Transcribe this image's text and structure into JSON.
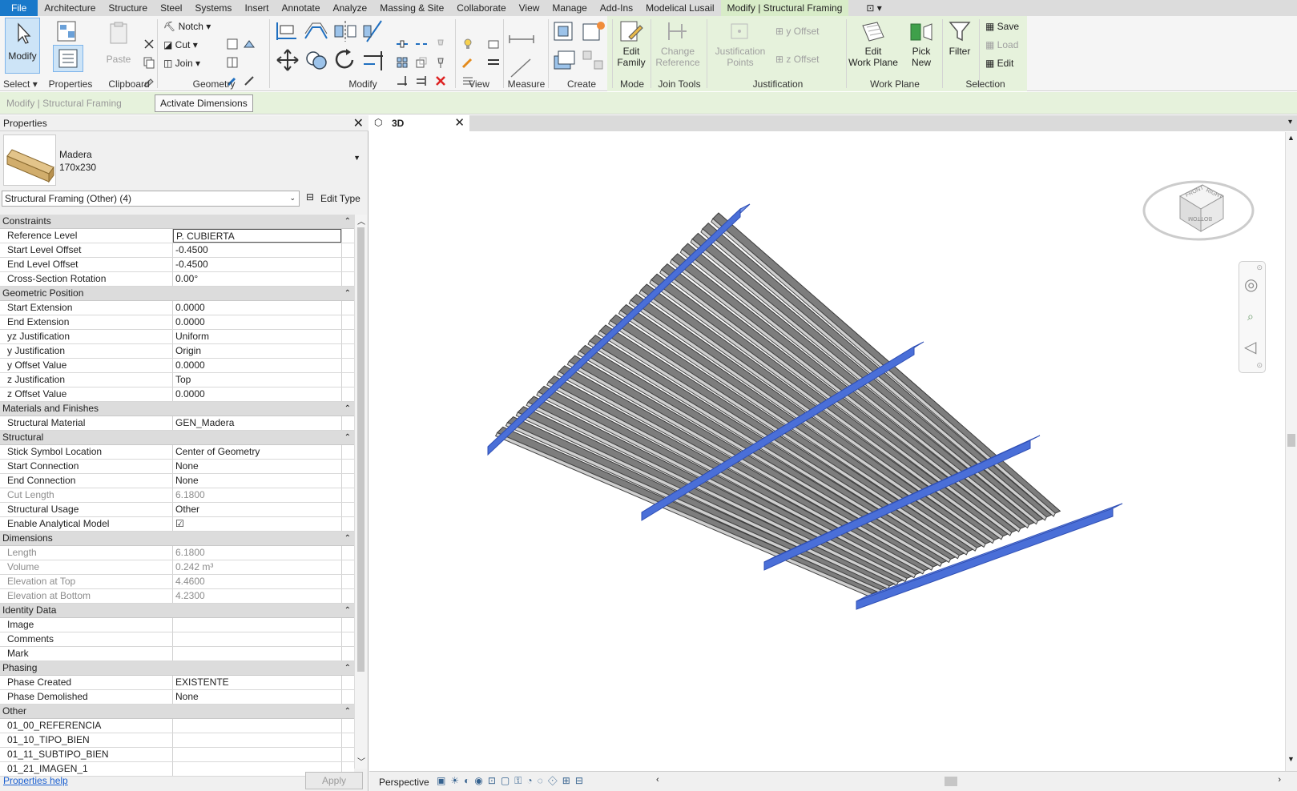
{
  "tabs": [
    "File",
    "Architecture",
    "Structure",
    "Steel",
    "Systems",
    "Insert",
    "Annotate",
    "Analyze",
    "Massing & Site",
    "Collaborate",
    "View",
    "Manage",
    "Add-Ins",
    "Modelical Lusail",
    "Modify | Structural Framing"
  ],
  "ribbon": {
    "modify": "Modify",
    "properties": "Properties",
    "paste": "Paste",
    "notch": "Notch",
    "cut": "Cut",
    "join": "Join",
    "edit_family": [
      "Edit",
      "Family"
    ],
    "change_reference": [
      "Change",
      "Reference"
    ],
    "justification_points": [
      "Justification",
      "Points"
    ],
    "y_offset": "y Offset",
    "z_offset": "z Offset",
    "edit_work_plane": [
      "Edit",
      "Work Plane"
    ],
    "pick_new": [
      "Pick",
      "New"
    ],
    "filter": "Filter",
    "save": "Save",
    "load": "Load",
    "edit": "Edit",
    "groups": [
      "Select",
      "Properties",
      "Clipboard",
      "Geometry",
      "Modify",
      "View",
      "Measure",
      "Create",
      "Mode",
      "Join Tools",
      "Justification",
      "Work Plane",
      "Selection"
    ]
  },
  "option_bar": {
    "context": "Modify | Structural Framing",
    "activate_dimensions": "Activate Dimensions"
  },
  "properties": {
    "title": "Properties",
    "type_name": "Madera",
    "type_size": "170x230",
    "selector": "Structural Framing (Other) (4)",
    "edit_type": "Edit Type",
    "help": "Properties help",
    "apply": "Apply",
    "sections": [
      {
        "name": "Constraints",
        "rows": [
          [
            "Reference Level",
            "P. CUBIERTA"
          ],
          [
            "Start Level Offset",
            "-0.4500"
          ],
          [
            "End Level Offset",
            "-0.4500"
          ],
          [
            "Cross-Section Rotation",
            "0.00°"
          ]
        ]
      },
      {
        "name": "Geometric Position",
        "rows": [
          [
            "Start Extension",
            "0.0000"
          ],
          [
            "End Extension",
            "0.0000"
          ],
          [
            "yz Justification",
            "Uniform"
          ],
          [
            "y Justification",
            "Origin"
          ],
          [
            "y Offset Value",
            "0.0000"
          ],
          [
            "z Justification",
            "Top"
          ],
          [
            "z Offset Value",
            "0.0000"
          ]
        ]
      },
      {
        "name": "Materials and Finishes",
        "rows": [
          [
            "Structural Material",
            "GEN_Madera"
          ]
        ]
      },
      {
        "name": "Structural",
        "rows": [
          [
            "Stick Symbol Location",
            "Center of Geometry"
          ],
          [
            "Start Connection",
            "None"
          ],
          [
            "End Connection",
            "None"
          ],
          [
            "Cut Length",
            "6.1800"
          ],
          [
            "Structural Usage",
            "Other"
          ],
          [
            "Enable Analytical Model",
            "☑"
          ]
        ]
      },
      {
        "name": "Dimensions",
        "rows": [
          [
            "Length",
            "6.1800"
          ],
          [
            "Volume",
            "0.242 m³"
          ],
          [
            "Elevation at Top",
            "4.4600"
          ],
          [
            "Elevation at Bottom",
            "4.2300"
          ]
        ]
      },
      {
        "name": "Identity Data",
        "rows": [
          [
            "Image",
            ""
          ],
          [
            "Comments",
            ""
          ],
          [
            "Mark",
            ""
          ]
        ]
      },
      {
        "name": "Phasing",
        "rows": [
          [
            "Phase Created",
            "EXISTENTE"
          ],
          [
            "Phase Demolished",
            "None"
          ]
        ]
      },
      {
        "name": "Other",
        "rows": [
          [
            "01_00_REFERENCIA",
            ""
          ],
          [
            "01_10_TIPO_BIEN",
            ""
          ],
          [
            "01_11_SUBTIPO_BIEN",
            ""
          ],
          [
            "01_21_IMAGEN_1",
            ""
          ]
        ]
      }
    ],
    "readonly": [
      "Cut Length",
      "Length",
      "Volume",
      "Elevation at Top",
      "Elevation at Bottom"
    ]
  },
  "view": {
    "tab": "3D",
    "status": "Perspective",
    "cube": [
      "FRONT",
      "RIGHT",
      "BOTTOM"
    ]
  },
  "colors": {
    "selected": "#4a6fd8",
    "ribbon_ctx": "#e6f2dc",
    "file_tab": "#1979ca"
  }
}
